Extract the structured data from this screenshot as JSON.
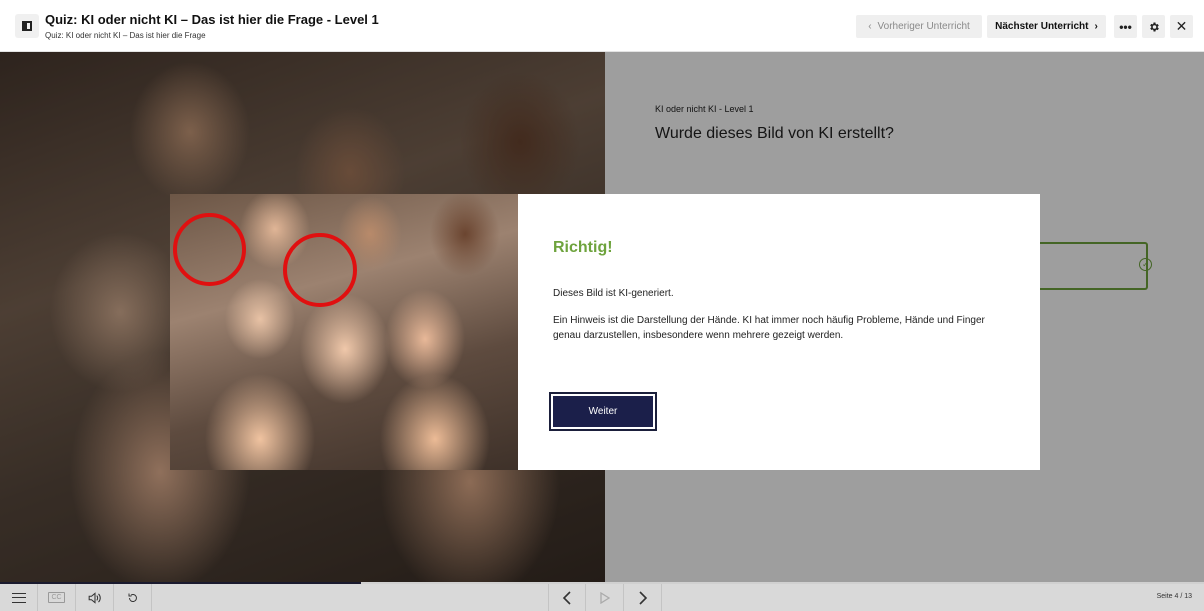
{
  "header": {
    "title": "Quiz: KI oder nicht KI – Das ist hier die Frage - Level 1",
    "subtitle": "Quiz: KI oder nicht KI – Das ist hier die Frage",
    "prev_lesson": "Vorheriger Unterricht",
    "next_lesson": "Nächster Unterricht",
    "more": "•••",
    "close": "✕"
  },
  "quiz": {
    "kicker": "KI oder nicht KI - Level 1",
    "question": "Wurde dieses Bild von KI erstellt?"
  },
  "feedback": {
    "title": "Richtig!",
    "line1": "Dieses Bild ist KI-generiert.",
    "line2": "Ein Hinweis ist die Darstellung der Hände. KI hat immer noch häufig Probleme, Hände und Finger genau darzustellen, insbesondere wenn mehrere gezeigt werden.",
    "continue_label": "Weiter"
  },
  "footer": {
    "cc_label": "CC",
    "page_counter": "Seite 4 / 13",
    "progress_fraction": 0.3
  },
  "colors": {
    "correct_green": "#6ea33d",
    "button_navy": "#1b1f4a",
    "marker_red": "#e01010"
  }
}
